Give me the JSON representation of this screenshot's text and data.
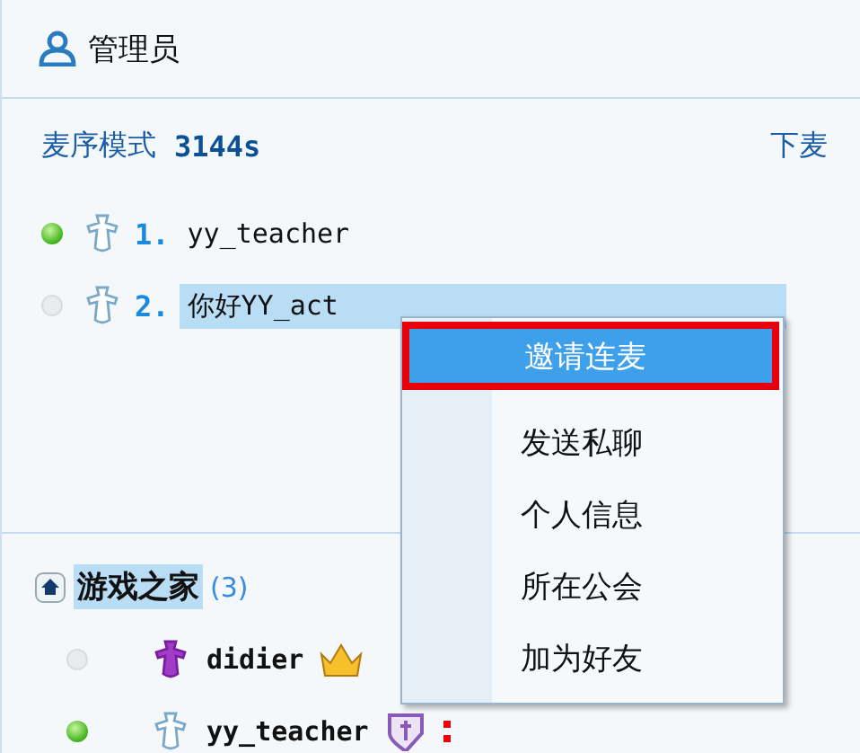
{
  "header": {
    "title": "管理员"
  },
  "queue": {
    "mode_label": "麦序模式",
    "timer": "3144s",
    "action": "下麦",
    "items": [
      {
        "number": "1.",
        "name": "yy_teacher",
        "online": true,
        "selected": false
      },
      {
        "number": "2.",
        "name": "你好YY_act",
        "online": false,
        "selected": true
      }
    ]
  },
  "context_menu": {
    "items": [
      {
        "label": "邀请连麦",
        "selected": true
      },
      {
        "label": "发送私聊",
        "selected": false
      },
      {
        "label": "个人信息",
        "selected": false
      },
      {
        "label": "所在公会",
        "selected": false
      },
      {
        "label": "加为好友",
        "selected": false
      }
    ]
  },
  "channel": {
    "name": "游戏之家",
    "count": "(3)",
    "selected": true,
    "members": [
      {
        "name": "didier",
        "online": false,
        "kind": "owner"
      },
      {
        "name": "yy_teacher",
        "online": true,
        "kind": "admin"
      }
    ]
  }
}
